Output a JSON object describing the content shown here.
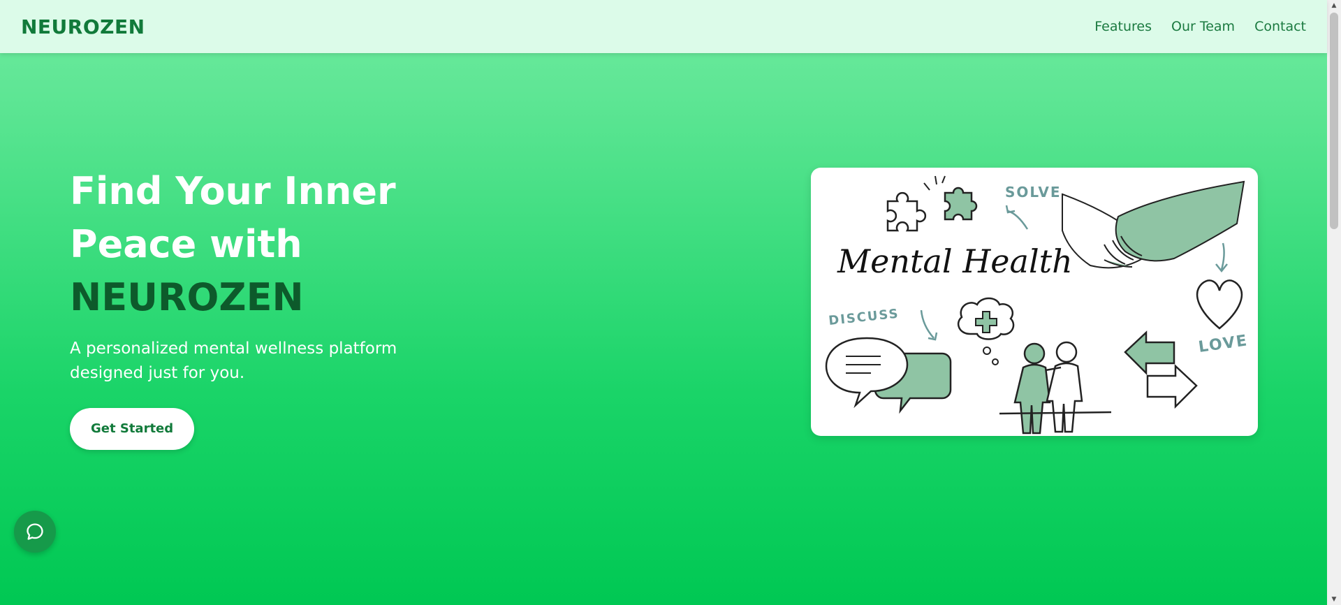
{
  "navbar": {
    "logo": "NEUROZEN",
    "links": [
      "Features",
      "Our Team",
      "Contact"
    ]
  },
  "hero": {
    "title_line1": "Find Your Inner",
    "title_line2": "Peace with",
    "title_brand": "NEUROZEN",
    "subtitle": "A personalized mental wellness platform designed just for you.",
    "cta_label": "Get Started"
  },
  "illustration": {
    "heading": "Mental Health",
    "label_solve": "SOLVE",
    "label_discuss": "DISCUSS",
    "label_love": "LOVE"
  },
  "icons": {
    "chat_fab": "chat-bubble-icon"
  },
  "colors": {
    "brand_dark": "#117a3a",
    "brand_deep": "#0d5a2b",
    "nav_bg": "#dcfbe9",
    "illustration_accent": "#8fc4a4",
    "fab_bg": "#169a4a"
  }
}
